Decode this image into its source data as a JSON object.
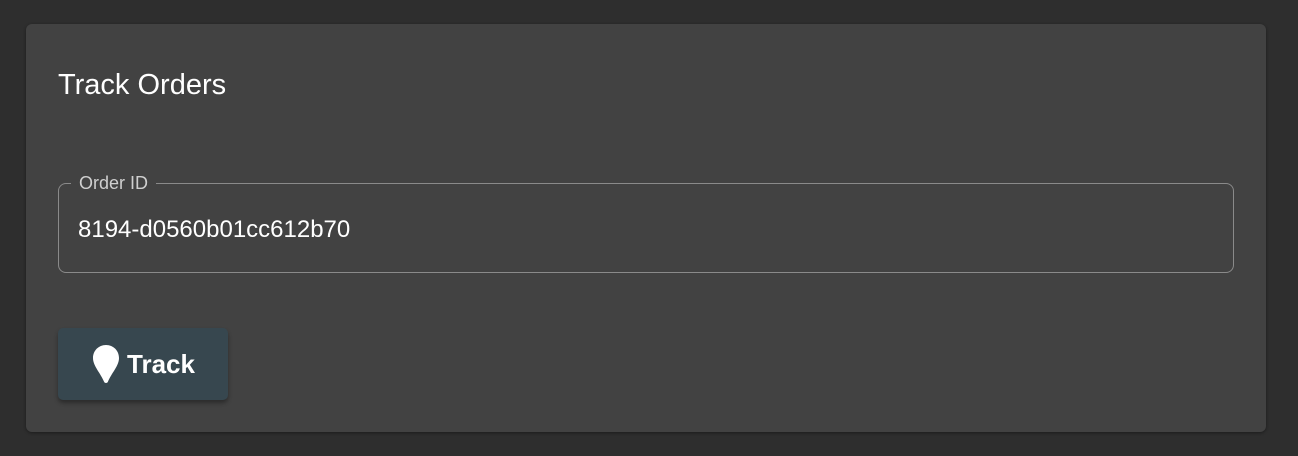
{
  "card": {
    "title": "Track Orders"
  },
  "order_field": {
    "label": "Order ID",
    "value": "8194-d0560b01cc612b70"
  },
  "track_button": {
    "label": "Track",
    "icon": "location-pin-icon"
  },
  "colors": {
    "page_background": "#2e2e2e",
    "card_background": "#424242",
    "button_background": "#37474f",
    "field_border": "#8a8a8a",
    "text": "#ffffff"
  }
}
